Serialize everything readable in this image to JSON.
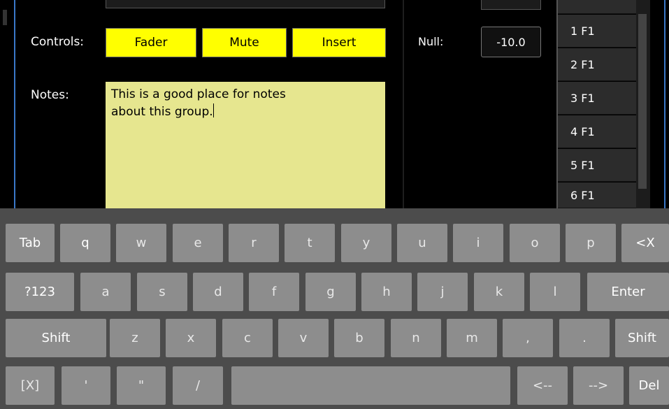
{
  "group": {
    "controls_label": "Controls:",
    "controls": [
      "Fader",
      "Mute",
      "Insert"
    ],
    "notes_label": "Notes:",
    "notes_text": "This is a good place for notes\nabout this group.",
    "null_label": "Null:",
    "null_value": "-10.0"
  },
  "list": {
    "items": [
      "1 F1",
      "2 F1",
      "3 F1",
      "4 F1",
      "5 F1",
      "6 F1"
    ]
  },
  "colors": {
    "control_button": "#ffff00",
    "notes_background": "#e6e68f",
    "divider_accent": "#3a78c8",
    "keyboard_background": "#4c4c4c",
    "key_background": "#8d8d8d"
  },
  "keyboard": {
    "row1": [
      "Tab",
      "q",
      "w",
      "e",
      "r",
      "t",
      "y",
      "u",
      "i",
      "o",
      "p",
      "<X"
    ],
    "row2": [
      "?123",
      "a",
      "s",
      "d",
      "f",
      "g",
      "h",
      "j",
      "k",
      "l",
      "Enter"
    ],
    "row3": [
      "Shift",
      "z",
      "x",
      "c",
      "v",
      "b",
      "n",
      "m",
      ",",
      ".",
      "Shift"
    ],
    "row4": [
      "[X]",
      "'",
      "\"",
      "/",
      "",
      "<--",
      "-->",
      "Del"
    ]
  }
}
